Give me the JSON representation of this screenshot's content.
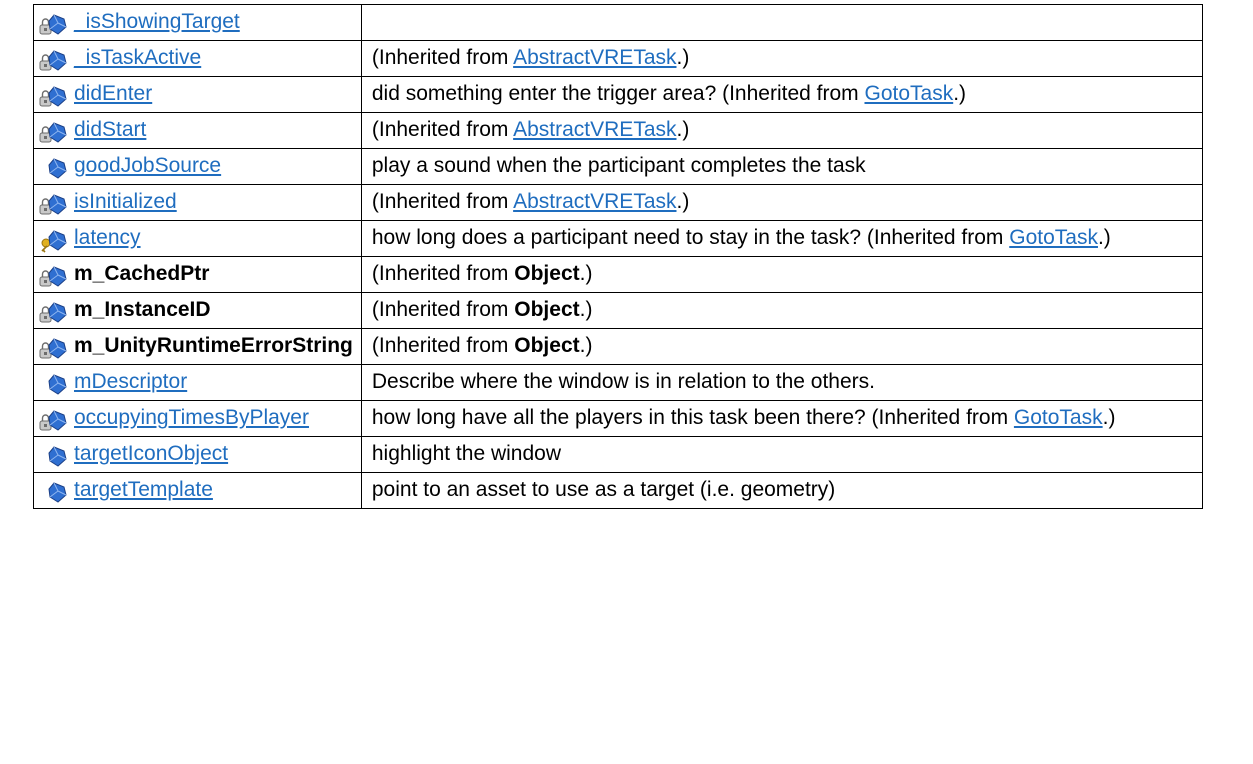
{
  "members": [
    {
      "name": "_isShowingTarget",
      "icon": "protected-field-icon",
      "link": true,
      "desc": []
    },
    {
      "name": "_isTaskActive",
      "icon": "protected-field-icon",
      "link": true,
      "desc": [
        {
          "t": " (Inherited from "
        },
        {
          "t": "AbstractVRETask",
          "link": true
        },
        {
          "t": ".)"
        }
      ]
    },
    {
      "name": "didEnter",
      "icon": "protected-field-icon",
      "link": true,
      "desc": [
        {
          "t": "did something enter the trigger area? (Inherited from "
        },
        {
          "t": "GotoTask",
          "link": true
        },
        {
          "t": ".)"
        }
      ]
    },
    {
      "name": "didStart",
      "icon": "protected-field-icon",
      "link": true,
      "desc": [
        {
          "t": " (Inherited from "
        },
        {
          "t": "AbstractVRETask",
          "link": true
        },
        {
          "t": ".)"
        }
      ]
    },
    {
      "name": "goodJobSource",
      "icon": "public-field-icon",
      "link": true,
      "desc": [
        {
          "t": "play a sound when the participant completes the task"
        }
      ]
    },
    {
      "name": "isInitialized",
      "icon": "protected-field-icon",
      "link": true,
      "desc": [
        {
          "t": " (Inherited from "
        },
        {
          "t": "AbstractVRETask",
          "link": true
        },
        {
          "t": ".)"
        }
      ]
    },
    {
      "name": "latency",
      "icon": "private-field-icon",
      "link": true,
      "desc": [
        {
          "t": "how long does a participant need to stay in the task? (Inherited from "
        },
        {
          "t": "GotoTask",
          "link": true
        },
        {
          "t": ".)"
        }
      ]
    },
    {
      "name": "m_CachedPtr",
      "icon": "protected-field-icon",
      "link": false,
      "desc": [
        {
          "t": " (Inherited from "
        },
        {
          "t": "Object",
          "bold": true
        },
        {
          "t": ".)"
        }
      ]
    },
    {
      "name": "m_InstanceID",
      "icon": "protected-field-icon",
      "link": false,
      "desc": [
        {
          "t": " (Inherited from "
        },
        {
          "t": "Object",
          "bold": true
        },
        {
          "t": ".)"
        }
      ]
    },
    {
      "name": "m_UnityRuntimeErrorString",
      "icon": "protected-field-icon",
      "link": false,
      "desc": [
        {
          "t": " (Inherited from "
        },
        {
          "t": "Object",
          "bold": true
        },
        {
          "t": ".)"
        }
      ]
    },
    {
      "name": "mDescriptor",
      "icon": "public-field-icon",
      "link": true,
      "desc": [
        {
          "t": "Describe where the window is in relation to the others."
        }
      ]
    },
    {
      "name": "occupyingTimesByPlayer",
      "icon": "protected-field-icon",
      "link": true,
      "desc": [
        {
          "t": "how long have all the players in this task been there? (Inherited from "
        },
        {
          "t": "GotoTask",
          "link": true
        },
        {
          "t": ".)"
        }
      ]
    },
    {
      "name": "targetIconObject",
      "icon": "public-field-icon",
      "link": true,
      "desc": [
        {
          "t": "highlight the window"
        }
      ]
    },
    {
      "name": "targetTemplate",
      "icon": "public-field-icon",
      "link": true,
      "desc": [
        {
          "t": "point to an asset to use as a target (i.e. geometry)"
        }
      ]
    }
  ],
  "colors": {
    "link": "#1f6dbf",
    "border": "#000000",
    "gem_blue": "#2f6fd1",
    "key_yellow": "#e0b020"
  }
}
